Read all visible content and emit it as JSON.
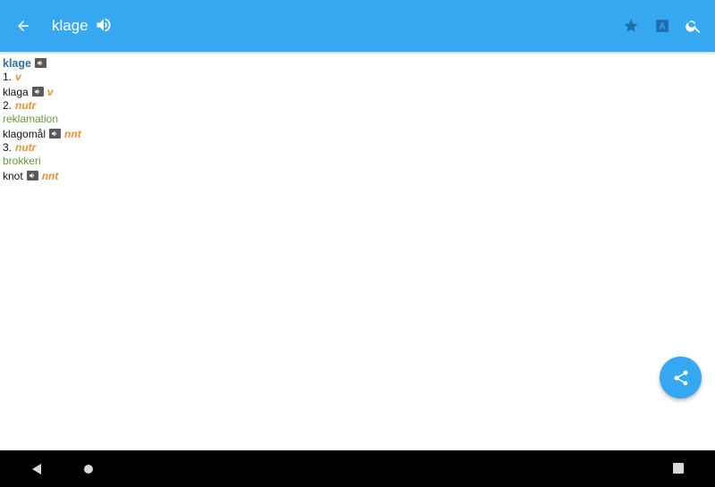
{
  "appbar": {
    "title": "klage",
    "background": "#35a8f1",
    "icons": {
      "back": "arrow-back-icon",
      "speaker": "speaker-icon",
      "favorite": "star-icon",
      "font": "font-size-icon",
      "search": "search-icon"
    }
  },
  "entry": {
    "headword": "klage",
    "senses": [
      {
        "number": "1.",
        "pos": "v",
        "items": [
          {
            "word": "klaga",
            "pos": "v"
          }
        ]
      },
      {
        "number": "2.",
        "pos": "nutr",
        "translation": "reklamation",
        "items": [
          {
            "word": "klagomål",
            "pos": "nnt"
          }
        ]
      },
      {
        "number": "3.",
        "pos": "nutr",
        "translation": "brokkeri",
        "items": [
          {
            "word": "knot",
            "pos": "nnt"
          }
        ]
      }
    ]
  },
  "fab": {
    "icon": "share-icon",
    "color": "#35a8f1"
  },
  "navbar": {
    "icons": [
      "nav-back-icon",
      "nav-home-icon",
      "nav-recents-icon"
    ]
  }
}
